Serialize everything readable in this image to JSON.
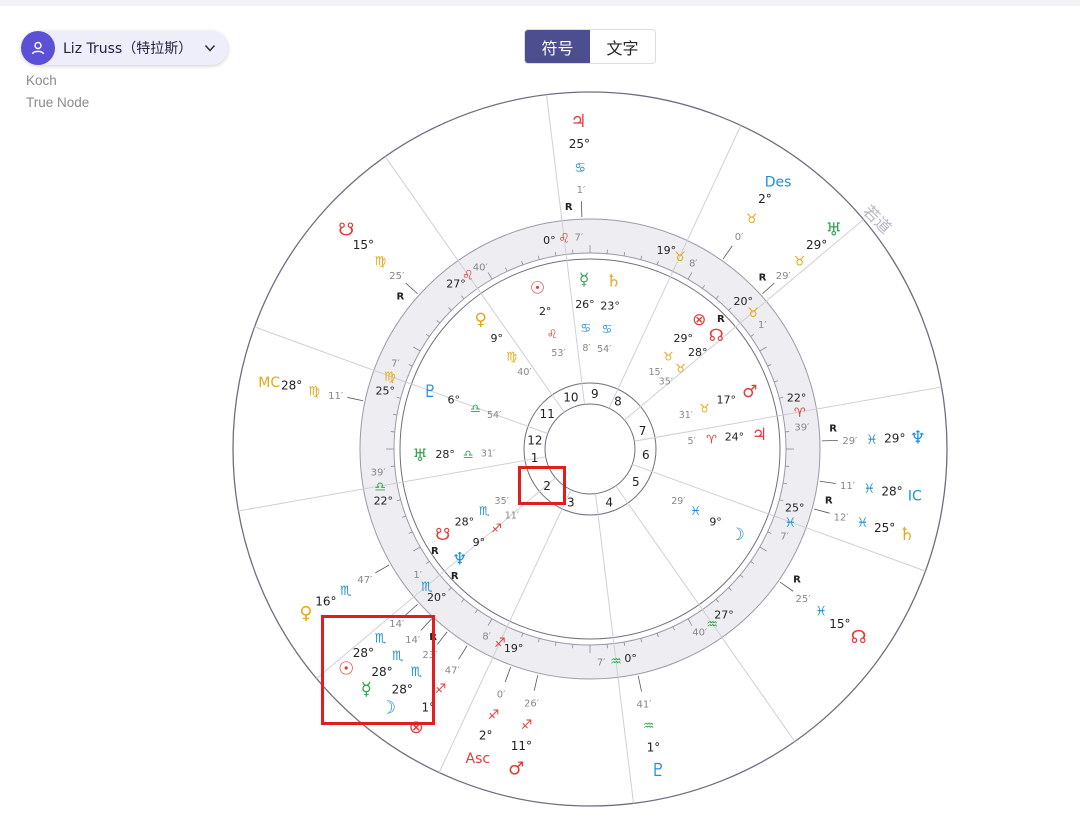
{
  "profile": {
    "name": "Liz Truss（特拉斯）",
    "avatar_icon": "user-icon",
    "chevron_icon": "chevron-down-icon"
  },
  "settings": {
    "house_system": "Koch",
    "node_type": "True Node"
  },
  "tabs": [
    {
      "label": "符号",
      "active": true
    },
    {
      "label": "文字",
      "active": false
    }
  ],
  "colors": {
    "accent": "#4c4e8f",
    "fire": "#e23a3a",
    "earth": "#e6a817",
    "air": "#2ea44f",
    "water": "#1f8fd6",
    "highlight": "#e21d1d"
  },
  "houses": [
    "1",
    "2",
    "3",
    "4",
    "5",
    "6",
    "7",
    "8",
    "9",
    "10",
    "11",
    "12"
  ],
  "cusps": [
    {
      "deg": "0°",
      "sign": "♌",
      "min": "7′"
    },
    {
      "deg": "19°",
      "sign": "♉",
      "min": "8′"
    },
    {
      "deg": "20°",
      "sign": "♉",
      "min": "1′"
    },
    {
      "deg": "22°",
      "sign": "♈",
      "min": "39′"
    },
    {
      "deg": "25°",
      "sign": "♓",
      "min": "7′"
    },
    {
      "deg": "27°",
      "sign": "♒",
      "min": "40′"
    },
    {
      "deg": "0°",
      "sign": "♒",
      "min": "7′"
    },
    {
      "deg": "19°",
      "sign": "♐",
      "min": "8′"
    },
    {
      "deg": "20°",
      "sign": "♏",
      "min": "1′"
    },
    {
      "deg": "22°",
      "sign": "♎",
      "min": "39′"
    },
    {
      "deg": "25°",
      "sign": "♍",
      "min": "7′"
    },
    {
      "deg": "27°",
      "sign": "♌",
      "min": "40′"
    }
  ],
  "natal": [
    {
      "glyph": "☉",
      "deg": "2°",
      "sign": "♌",
      "min": "53′",
      "r": ""
    },
    {
      "glyph": "☿",
      "deg": "26°",
      "sign": "♋",
      "min": "8′",
      "r": ""
    },
    {
      "glyph": "♄",
      "deg": "23°",
      "sign": "♋",
      "min": "54′",
      "r": ""
    },
    {
      "glyph": "♀",
      "deg": "9°",
      "sign": "♍",
      "min": "40′",
      "r": ""
    },
    {
      "glyph": "♇",
      "deg": "6°",
      "sign": "♎",
      "min": "54′",
      "r": ""
    },
    {
      "glyph": "♅",
      "deg": "28°",
      "sign": "♎",
      "min": "31′",
      "r": ""
    },
    {
      "glyph": "⊗",
      "deg": "29°",
      "sign": "♉",
      "min": "15′",
      "r": ""
    },
    {
      "glyph": "☊",
      "deg": "28°",
      "sign": "♉",
      "min": "35′",
      "r": "R"
    },
    {
      "glyph": "♂",
      "deg": "17°",
      "sign": "♉",
      "min": "31′",
      "r": ""
    },
    {
      "glyph": "♃",
      "deg": "24°",
      "sign": "♈",
      "min": "5′",
      "r": ""
    },
    {
      "glyph": "☋",
      "deg": "28°",
      "sign": "♏",
      "min": "35′",
      "r": "R"
    },
    {
      "glyph": "♆",
      "deg": "9°",
      "sign": "♐",
      "min": "11′",
      "r": "R"
    },
    {
      "glyph": "☽",
      "deg": "9°",
      "sign": "♓",
      "min": "29′",
      "r": ""
    }
  ],
  "transit": [
    {
      "glyph": "♃",
      "deg": "25°",
      "sign": "♋",
      "min": "1′",
      "r": "R"
    },
    {
      "glyph": "Des",
      "deg": "2°",
      "sign": "♉",
      "min": "0′",
      "r": ""
    },
    {
      "glyph": "♅",
      "deg": "29°",
      "sign": "♉",
      "min": "29′",
      "r": "R"
    },
    {
      "glyph": "♆",
      "deg": "29°",
      "sign": "♓",
      "min": "29′",
      "r": "R"
    },
    {
      "glyph": "IC",
      "deg": "28°",
      "sign": "♓",
      "min": "11′",
      "r": ""
    },
    {
      "glyph": "♄",
      "deg": "25°",
      "sign": "♓",
      "min": "12′",
      "r": "R"
    },
    {
      "glyph": "☊",
      "deg": "15°",
      "sign": "♓",
      "min": "25′",
      "r": "R"
    },
    {
      "glyph": "♇",
      "deg": "1°",
      "sign": "♒",
      "min": "41′",
      "r": ""
    },
    {
      "glyph": "♂",
      "deg": "11°",
      "sign": "♐",
      "min": "26′",
      "r": ""
    },
    {
      "glyph": "Asc",
      "deg": "2°",
      "sign": "♐",
      "min": "0′",
      "r": ""
    },
    {
      "glyph": "⊗",
      "deg": "1°",
      "sign": "♐",
      "min": "47′",
      "r": ""
    },
    {
      "glyph": "☽",
      "deg": "28°",
      "sign": "♏",
      "min": "23′",
      "r": ""
    },
    {
      "glyph": "☿",
      "deg": "28°",
      "sign": "♏",
      "min": "14′",
      "r": "R"
    },
    {
      "glyph": "☉",
      "deg": "28°",
      "sign": "♏",
      "min": "14′",
      "r": ""
    },
    {
      "glyph": "♀",
      "deg": "16°",
      "sign": "♏",
      "min": "47′",
      "r": ""
    },
    {
      "glyph": "MC",
      "deg": "28°",
      "sign": "♍",
      "min": "11′",
      "r": ""
    },
    {
      "glyph": "☋",
      "deg": "15°",
      "sign": "♍",
      "min": "25′",
      "r": "R"
    }
  ],
  "watermark": "若道"
}
